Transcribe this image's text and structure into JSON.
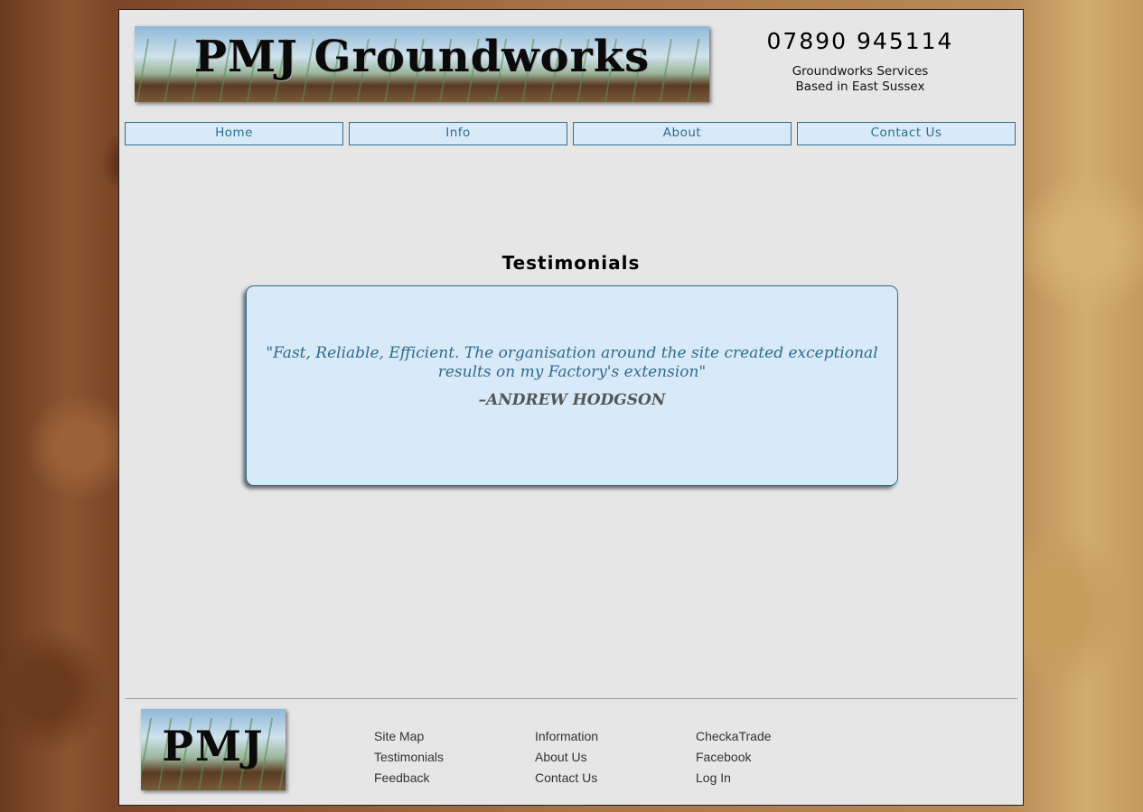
{
  "header": {
    "logo_text": "PMJ Groundworks",
    "phone": "07890 945114",
    "tagline_line1": "Groundworks Services",
    "tagline_line2": "Based in East Sussex"
  },
  "nav": [
    {
      "label": "Home"
    },
    {
      "label": "Info"
    },
    {
      "label": "About"
    },
    {
      "label": "Contact Us"
    }
  ],
  "main": {
    "heading": "Testimonials",
    "testimonial": {
      "quote": "\"Fast, Reliable, Efficient. The organisation around the site created exceptional results on my Factory's extension\"",
      "author": "–ANDREW HODGSON"
    }
  },
  "footer": {
    "logo_text": "PMJ",
    "columns": [
      [
        {
          "label": "Site Map"
        },
        {
          "label": "Testimonials"
        },
        {
          "label": "Feedback"
        }
      ],
      [
        {
          "label": "Information"
        },
        {
          "label": "About Us"
        },
        {
          "label": "Contact Us"
        }
      ],
      [
        {
          "label": "CheckaTrade"
        },
        {
          "label": "Facebook"
        },
        {
          "label": "Log In"
        }
      ]
    ]
  },
  "colors": {
    "nav_bg": "#d8e9f7",
    "nav_border": "#2d6f93",
    "accent_text": "#2f6b8f"
  }
}
